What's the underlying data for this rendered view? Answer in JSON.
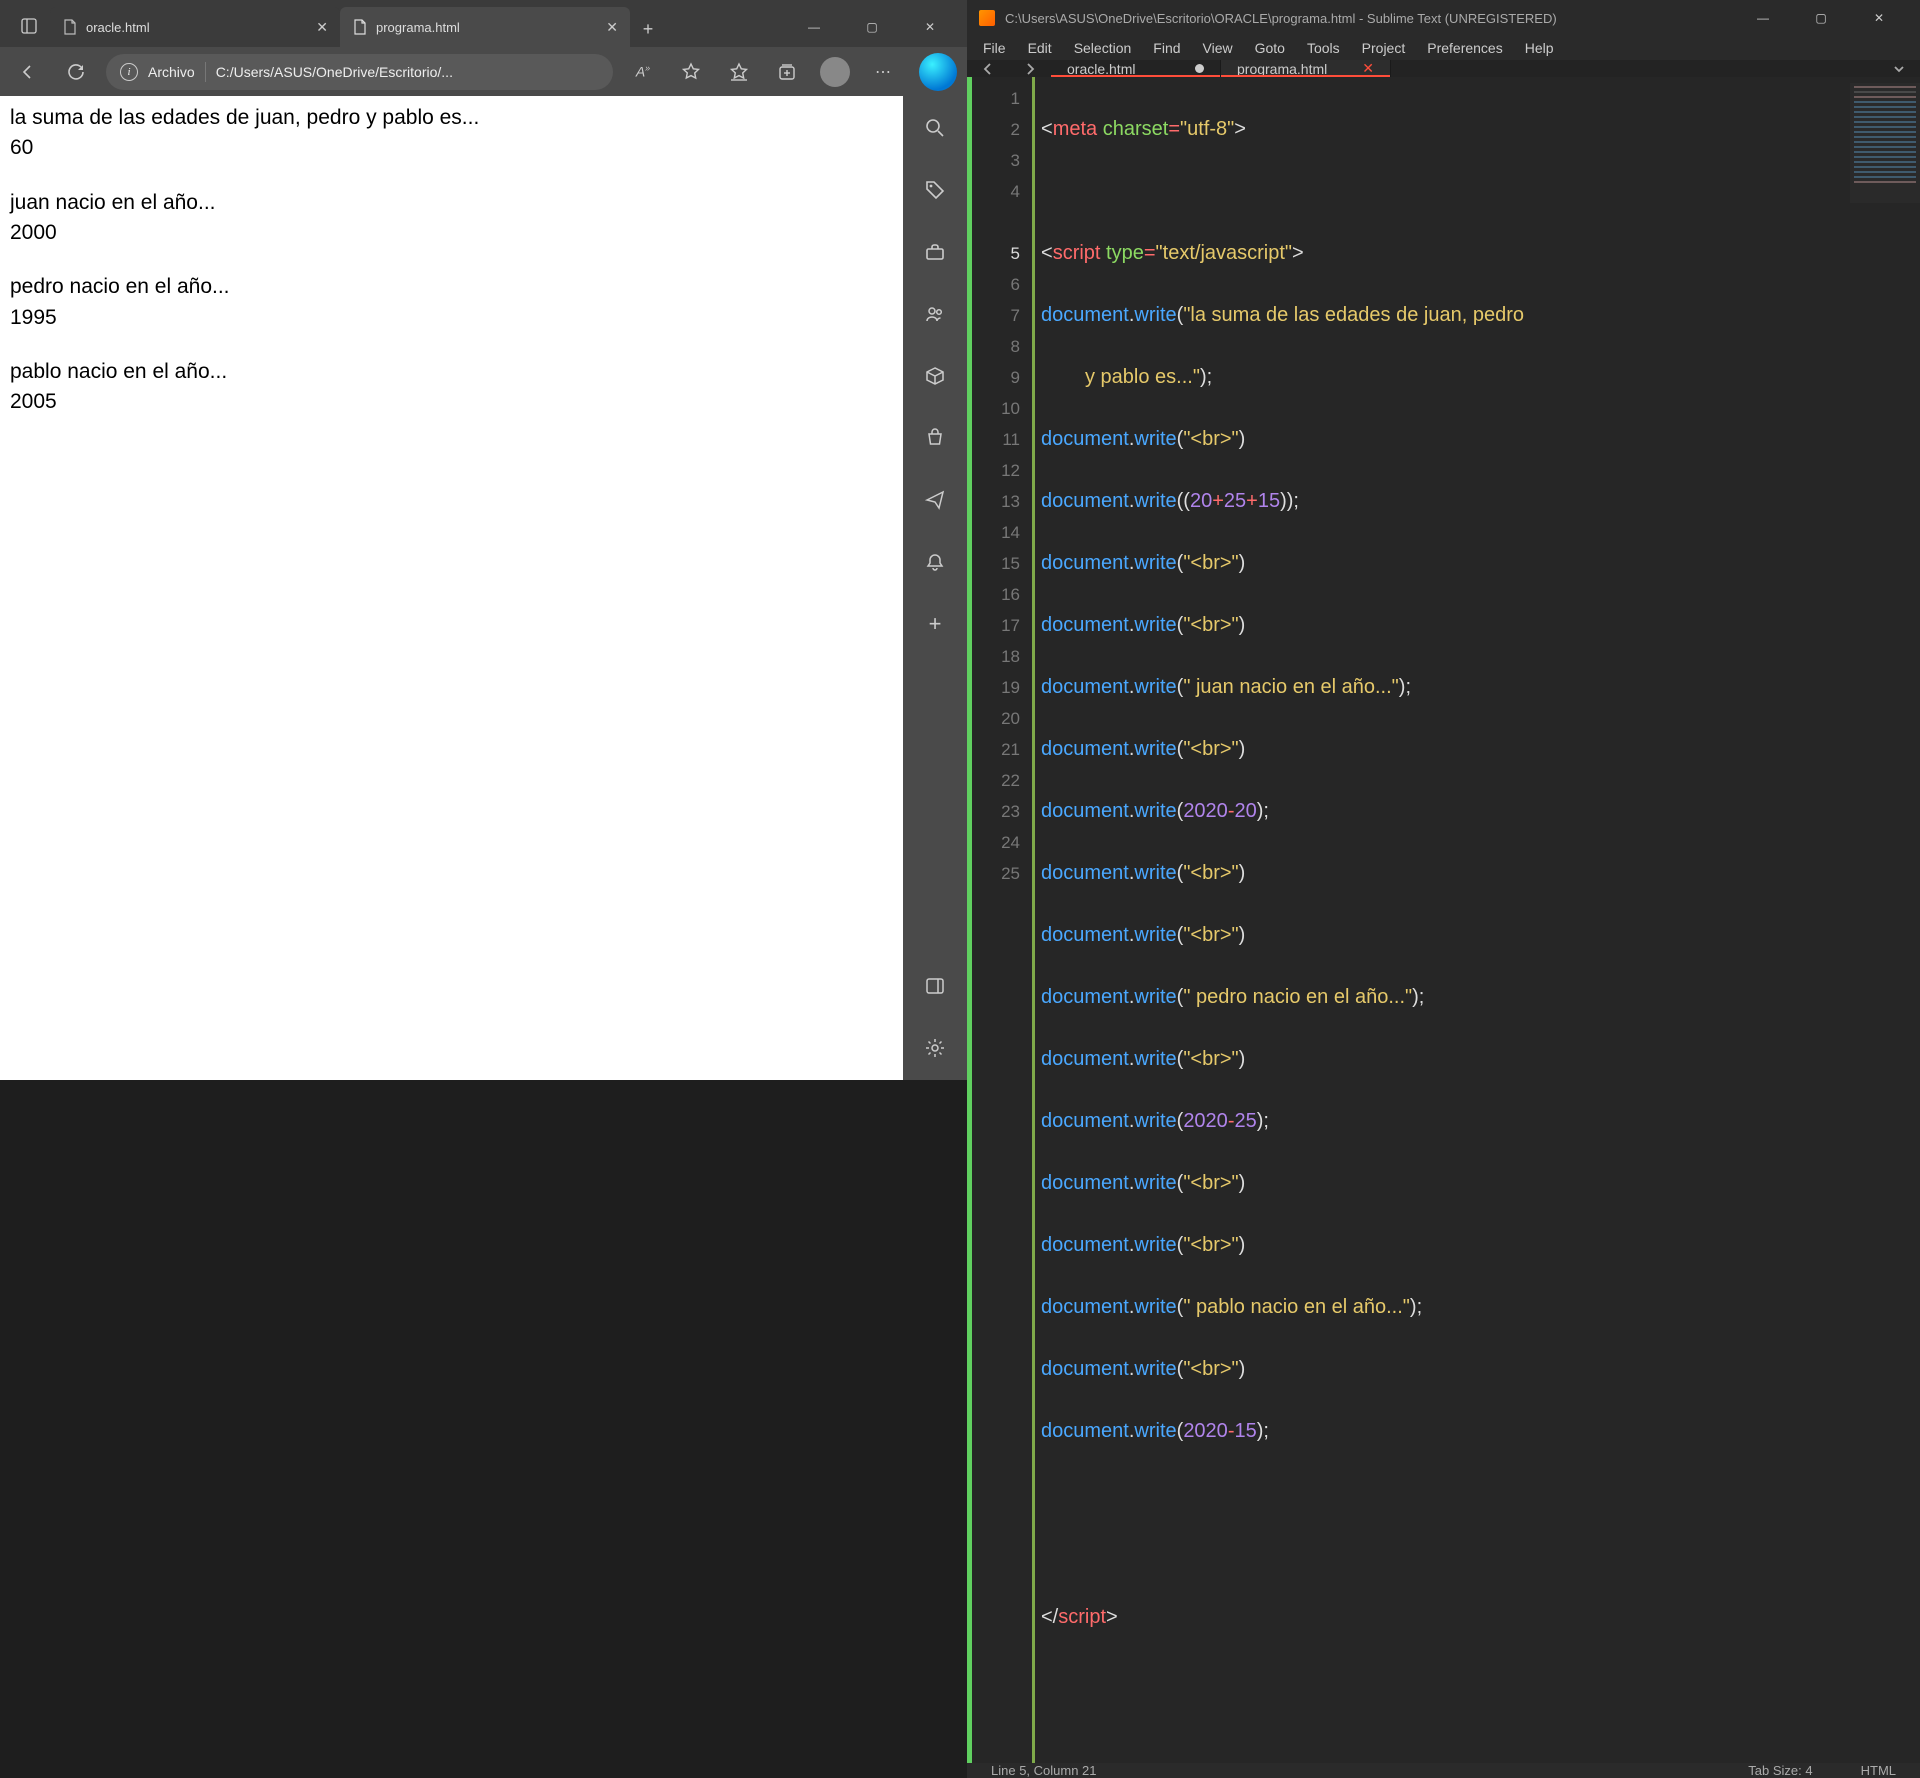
{
  "browser": {
    "tabs": [
      {
        "title": "oracle.html",
        "active": false
      },
      {
        "title": "programa.html",
        "active": true
      }
    ],
    "address": {
      "kind_label": "Archivo",
      "path": "C:/Users/ASUS/OneDrive/Escritorio/..."
    },
    "toolbar_icons": [
      "reading-mode",
      "favorite",
      "collections",
      "apps",
      "profile",
      "more",
      "bing"
    ],
    "sidebar_icons": [
      "search",
      "tag",
      "toolbox",
      "chat",
      "cube",
      "shopping",
      "send",
      "bell",
      "add"
    ],
    "sidebar_bottom": [
      "panel",
      "settings"
    ]
  },
  "page_output": {
    "l1": "la suma de las edades de juan, pedro y pablo es...",
    "v1": "60",
    "l2": "juan nacio en el año...",
    "v2": "2000",
    "l3": "pedro nacio en el año...",
    "v3": "1995",
    "l4": "pablo nacio en el año...",
    "v4": "2005"
  },
  "sublime": {
    "title": "C:\\Users\\ASUS\\OneDrive\\Escritorio\\ORACLE\\programa.html - Sublime Text (UNREGISTERED)",
    "menu": [
      "File",
      "Edit",
      "Selection",
      "Find",
      "View",
      "Goto",
      "Tools",
      "Project",
      "Preferences",
      "Help"
    ],
    "tabs": [
      {
        "name": "oracle.html",
        "dirty": true,
        "active": false
      },
      {
        "name": "programa.html",
        "dirty": false,
        "active": true
      }
    ],
    "status": {
      "pos": "Line 5, Column 21",
      "tab": "Tab Size: 4",
      "syntax": "HTML"
    },
    "active_line": 5,
    "code": {
      "meta_tag": "meta",
      "meta_attr": "charset",
      "meta_eq": "=",
      "meta_val": "\"utf-8\"",
      "script_tag": "script",
      "script_attr": "type",
      "script_val": "\"text/javascript\"",
      "obj": "document",
      "fn": "write",
      "s_sum": "\"la suma de las edades de juan, pedro ",
      "s_sum2": "y pablo es...\"",
      "s_br": "\"<br>\"",
      "n20": "20",
      "n25": "25",
      "n15": "15",
      "s_juan": "\" juan nacio en el año...\"",
      "n2020": "2020",
      "s_pedro": "\" pedro nacio en el año...\"",
      "s_pablo": "\" pablo nacio en el año...\""
    }
  }
}
